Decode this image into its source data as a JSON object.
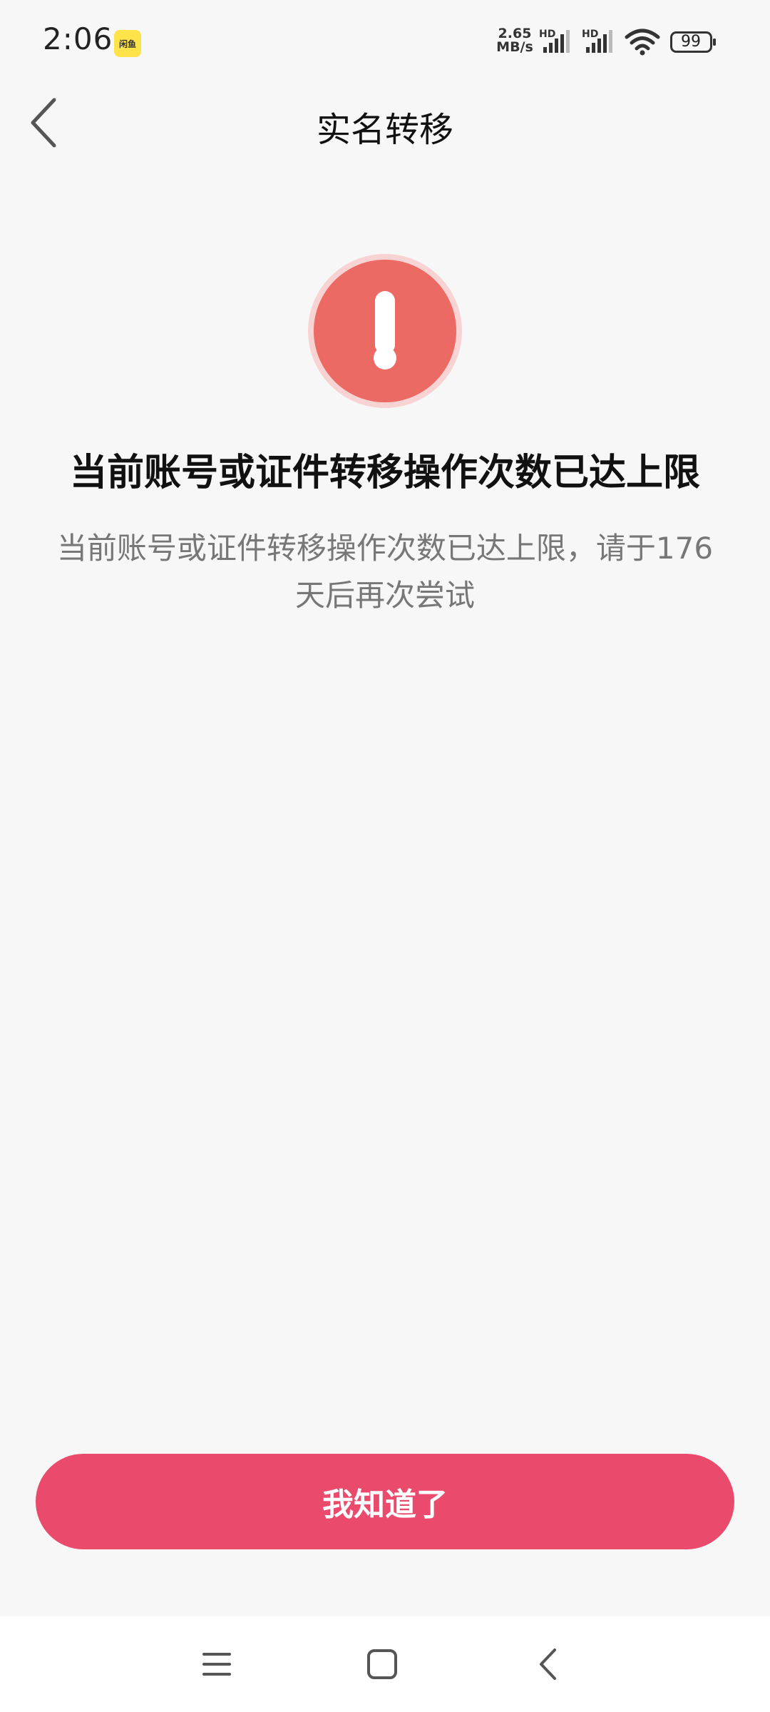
{
  "status_bar": {
    "time": "2:06",
    "app_icon_label": "闲鱼",
    "net_speed_value": "2.65",
    "net_speed_unit": "MB/s",
    "hd_label_1": "HD",
    "hd_label_2": "HD",
    "battery": "99"
  },
  "header": {
    "title": "实名转移"
  },
  "alert": {
    "title": "当前账号或证件转移操作次数已达上限",
    "description": "当前账号或证件转移操作次数已达上限，请于176天后再次尝试"
  },
  "actions": {
    "confirm_label": "我知道了"
  },
  "colors": {
    "accent": "#ea4a6c",
    "alert": "#ec6a64"
  },
  "icons": {
    "back": "chevron-left-icon",
    "alert": "exclamation-icon",
    "nav_menu": "menu-icon",
    "nav_home": "square-icon",
    "nav_back": "chevron-left-icon"
  }
}
